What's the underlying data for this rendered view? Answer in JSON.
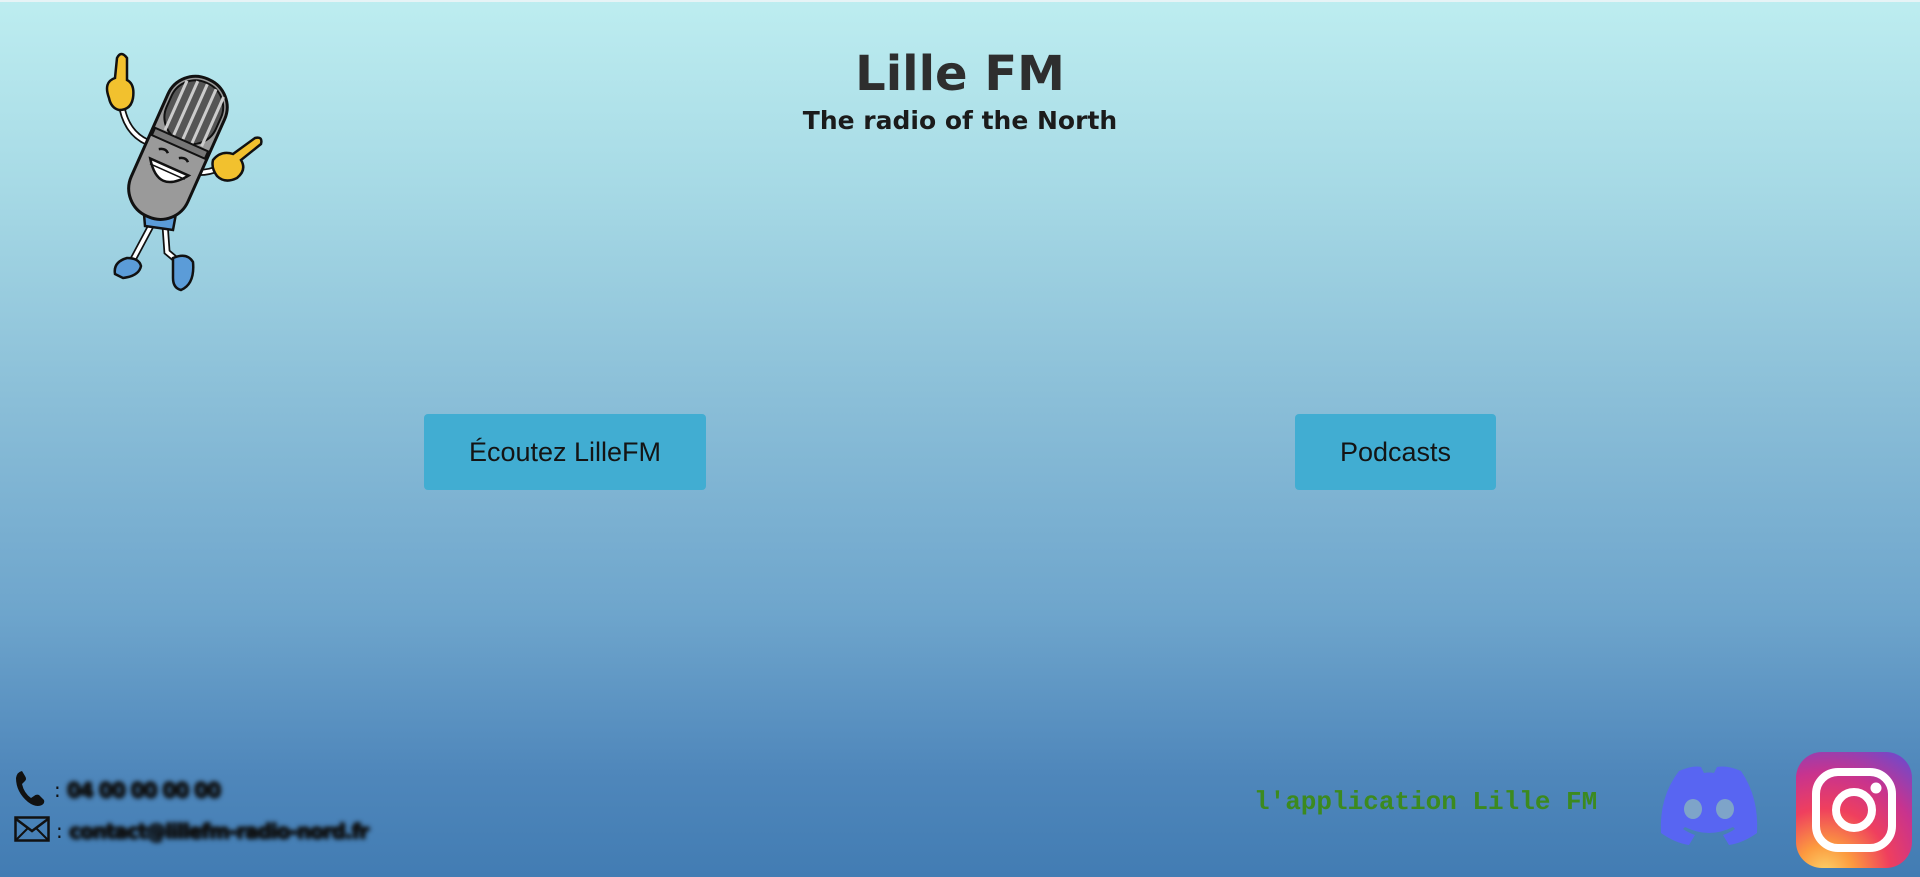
{
  "header": {
    "title": "Lille FM",
    "subtitle": "The radio of the North"
  },
  "mascot": {
    "icon": "microphone-mascot-icon"
  },
  "buttons": {
    "listen_label": "Écoutez LilleFM",
    "podcasts_label": "Podcasts"
  },
  "contact": {
    "phone_icon": "phone-icon",
    "phone_separator": ":",
    "phone_value": "04 00 00 00 00",
    "mail_icon": "mail-icon",
    "mail_separator": ":",
    "mail_value": "contact@lillefm-radio-nord.fr"
  },
  "footer": {
    "app_text": "l'application Lille FM",
    "discord_icon": "discord-icon",
    "instagram_icon": "instagram-icon"
  },
  "colors": {
    "button_bg": "#41add2",
    "app_text": "#3c8a1f",
    "discord": "#5865f2",
    "gradient_top": "#bdedf0",
    "gradient_bottom": "#427cb3"
  }
}
